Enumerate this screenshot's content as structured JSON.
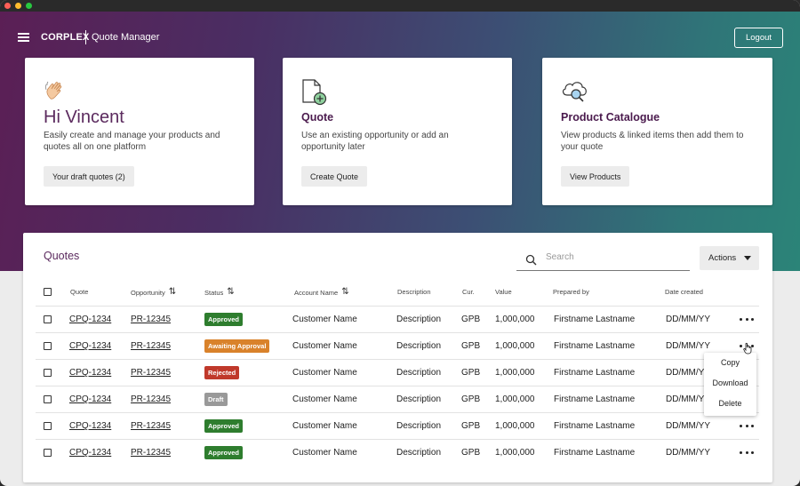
{
  "header": {
    "brand": "CORPLEX",
    "app_name": "Quote Manager",
    "logout_label": "Logout"
  },
  "cards": {
    "welcome": {
      "icon": "waving-hand-icon",
      "title": "Hi Vincent",
      "description": "Easily create and manage your products and quotes all on one platform",
      "button_label": "Your draft quotes (2)"
    },
    "quote": {
      "icon": "new-document-icon",
      "title": "Quote",
      "description": "Use an existing opportunity or add an opportunity later",
      "button_label": "Create Quote"
    },
    "catalogue": {
      "icon": "cloud-search-icon",
      "title": "Product Catalogue",
      "description": "View products & linked items then add them to your quote",
      "button_label": "View Products"
    }
  },
  "quotes": {
    "title": "Quotes",
    "search_placeholder": "Search",
    "actions_label": "Actions",
    "columns": {
      "quote": "Quote",
      "opportunity": "Opportunity",
      "status": "Status",
      "account_name": "Account Name",
      "description": "Description",
      "currency": "Cur.",
      "value": "Value",
      "prepared_by": "Prepared by",
      "date_created": "Date created"
    },
    "rows": [
      {
        "quote": "CPQ-1234",
        "opportunity": "PR-12345",
        "status": "Approved",
        "status_color": "#2e7d2e",
        "account": "Customer Name",
        "description": "Description",
        "currency": "GPB",
        "value": "1,000,000",
        "prepared_by": "Firstname Lastname",
        "date": "DD/MM/YY"
      },
      {
        "quote": "CPQ-1234",
        "opportunity": "PR-12345",
        "status": "Awaiting Approval",
        "status_color": "#d9822b",
        "account": "Customer Name",
        "description": "Description",
        "currency": "GPB",
        "value": "1,000,000",
        "prepared_by": "Firstname Lastname",
        "date": "DD/MM/YY"
      },
      {
        "quote": "CPQ-1234",
        "opportunity": "PR-12345",
        "status": "Rejected",
        "status_color": "#c0392b",
        "account": "Customer Name",
        "description": "Description",
        "currency": "GPB",
        "value": "1,000,000",
        "prepared_by": "Firstname Lastname",
        "date": "DD/MM/YY"
      },
      {
        "quote": "CPQ-1234",
        "opportunity": "PR-12345",
        "status": "Draft",
        "status_color": "#999999",
        "account": "Customer Name",
        "description": "Description",
        "currency": "GPB",
        "value": "1,000,000",
        "prepared_by": "Firstname Lastname",
        "date": "DD/MM/YY"
      },
      {
        "quote": "CPQ-1234",
        "opportunity": "PR-12345",
        "status": "Approved",
        "status_color": "#2e7d2e",
        "account": "Customer Name",
        "description": "Description",
        "currency": "GPB",
        "value": "1,000,000",
        "prepared_by": "Firstname Lastname",
        "date": "DD/MM/YY"
      },
      {
        "quote": "CPQ-1234",
        "opportunity": "PR-12345",
        "status": "Approved",
        "status_color": "#2e7d2e",
        "account": "Customer Name",
        "description": "Description",
        "currency": "GPB",
        "value": "1,000,000",
        "prepared_by": "Firstname Lastname",
        "date": "DD/MM/YY"
      }
    ]
  },
  "row_menu": {
    "copy": "Copy",
    "download": "Download",
    "delete": "Delete"
  },
  "colors": {
    "accent": "#5b2a5e",
    "hero_start": "#5b1f55",
    "hero_end": "#2b8478"
  }
}
